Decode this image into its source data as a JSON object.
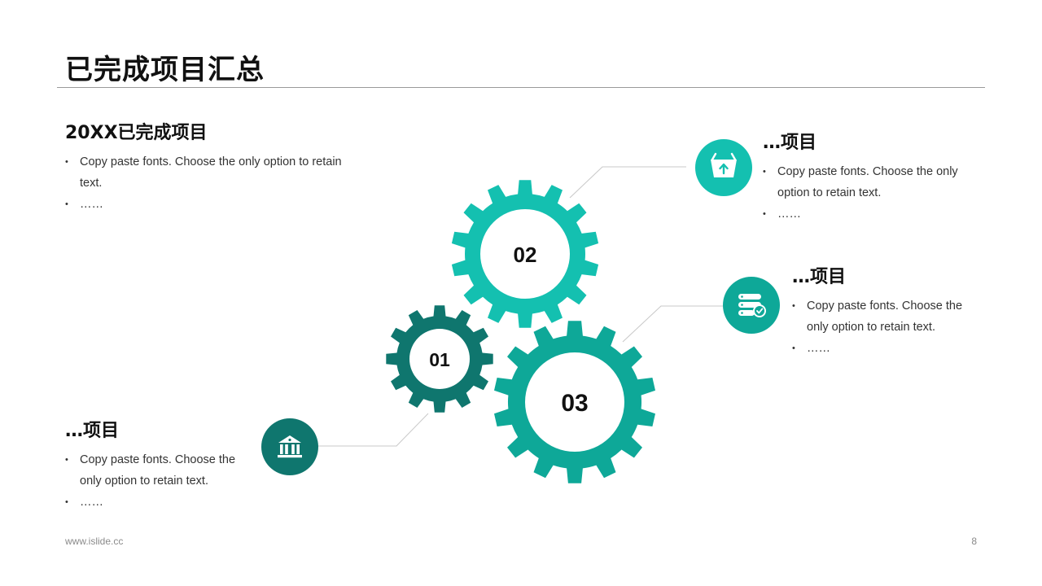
{
  "title": "已完成项目汇总",
  "blocks": {
    "main": {
      "heading": "20XX已完成项目",
      "items": [
        "Copy paste fonts. Choose the only option to retain text.",
        "……"
      ]
    },
    "top_right": {
      "heading": "…项目",
      "items": [
        "Copy paste fonts. Choose the only option to retain text.",
        "……"
      ]
    },
    "mid_right": {
      "heading": "…项目",
      "items": [
        "Copy paste fonts. Choose the only option to retain text.",
        "……"
      ]
    },
    "bottom_left": {
      "heading": "…项目",
      "items": [
        "Copy paste fonts. Choose the only option to retain text.",
        "……"
      ]
    }
  },
  "gears": {
    "g1": {
      "label": "01",
      "color": "#0f766e"
    },
    "g2": {
      "label": "02",
      "color": "#14c0b0"
    },
    "g3": {
      "label": "03",
      "color": "#0ea898"
    }
  },
  "icons": {
    "basket": {
      "icon": "basket-upload-icon",
      "color": "#14c0b0"
    },
    "server": {
      "icon": "server-check-icon",
      "color": "#0ea898"
    },
    "bank": {
      "icon": "bank-icon",
      "color": "#0f766e"
    }
  },
  "footer": {
    "website": "www.islide.cc",
    "page_number": "8"
  }
}
